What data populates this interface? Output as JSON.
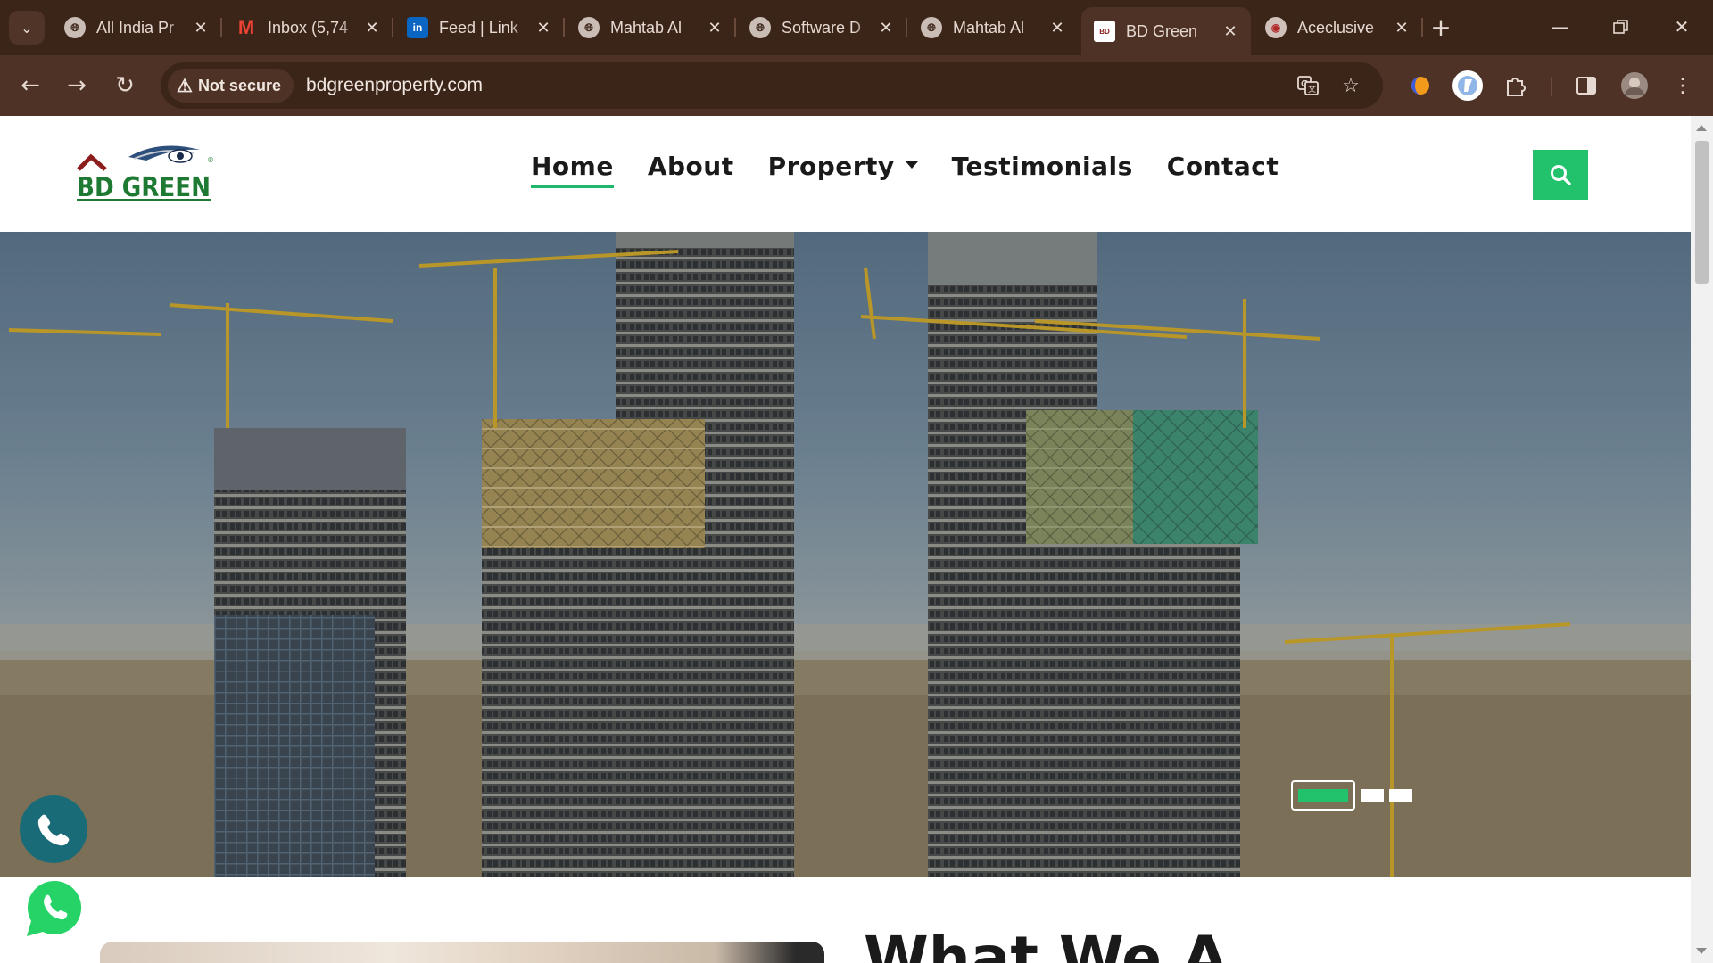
{
  "browser": {
    "tabs": [
      {
        "title": "All India Pr",
        "favicon": "globe-icon"
      },
      {
        "title": "Inbox (5,74",
        "favicon": "gmail-icon"
      },
      {
        "title": "Feed | Link",
        "favicon": "linkedin-icon"
      },
      {
        "title": "Mahtab Al",
        "favicon": "globe-icon"
      },
      {
        "title": "Software D",
        "favicon": "globe-icon"
      },
      {
        "title": "Mahtab Al",
        "favicon": "globe-icon"
      },
      {
        "title": "BD Green",
        "favicon": "bdgreen-icon",
        "active": true
      },
      {
        "title": "Aceclusive",
        "favicon": "aceclusive-icon"
      }
    ],
    "security_label": "Not secure",
    "url": "bdgreenproperty.com",
    "colors": {
      "frame": "#3b2418",
      "toolbar": "#4e3226"
    }
  },
  "site": {
    "logo_text": "BD GREEN",
    "logo_mark": "®",
    "nav": [
      {
        "label": "Home",
        "active": true
      },
      {
        "label": "About"
      },
      {
        "label": "Property",
        "dropdown": true
      },
      {
        "label": "Testimonials"
      },
      {
        "label": "Contact"
      }
    ],
    "hero": {
      "image": "buildings-under-construction-with-cranes",
      "slides_total": 3,
      "slide_active": 1
    },
    "section_title_partial": "What We A",
    "colors": {
      "accent": "#22c16b",
      "call": "#1a6b78",
      "whatsapp": "#25d366",
      "logo_red": "#8b1d1d",
      "logo_green": "#1e7a32"
    }
  }
}
